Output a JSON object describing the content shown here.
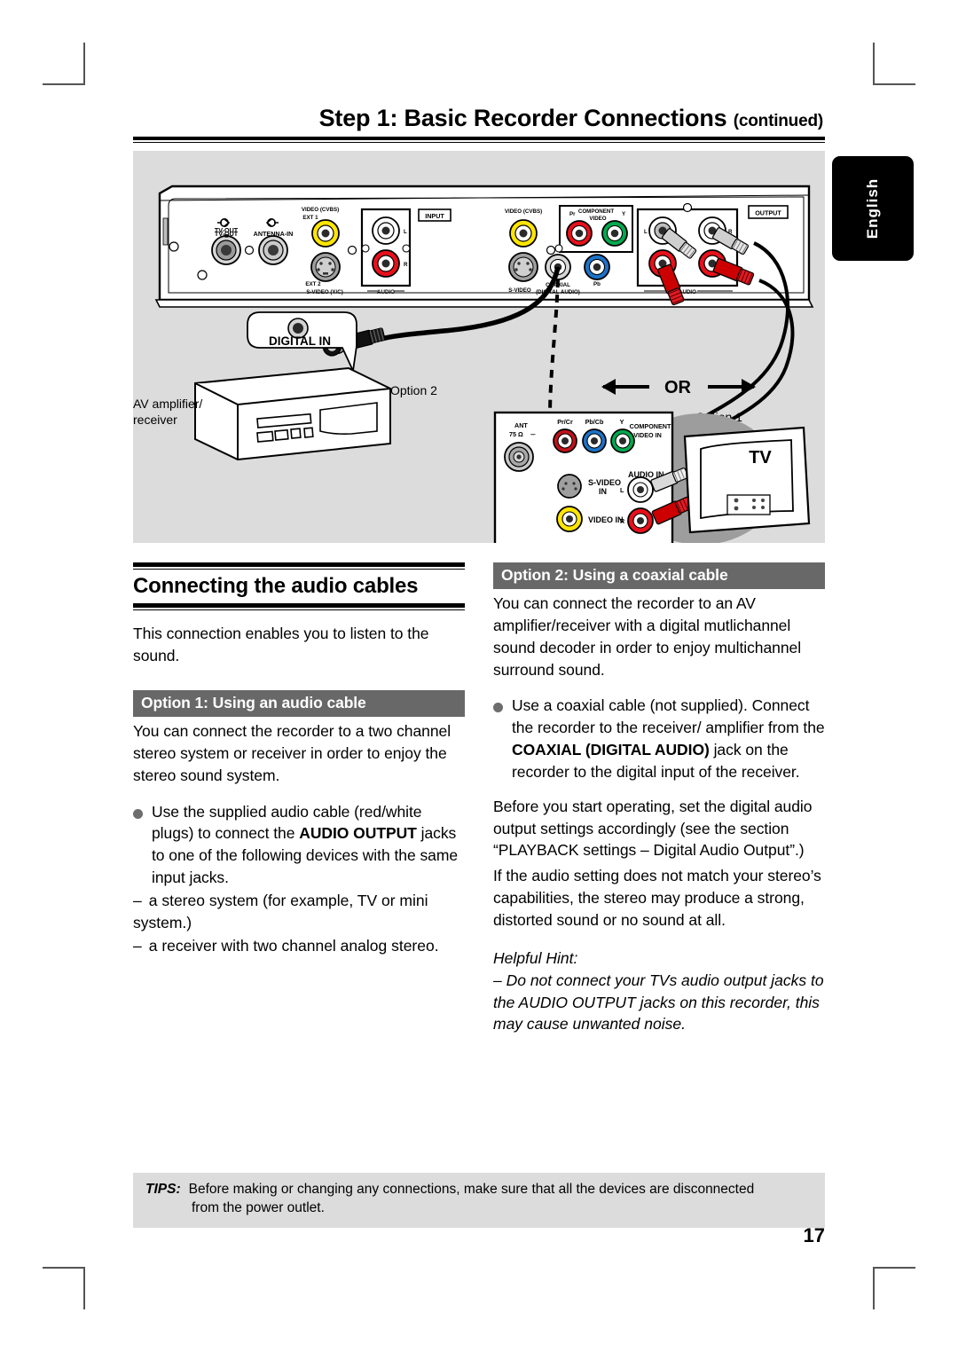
{
  "header": {
    "title": "Step 1: Basic Recorder Connections",
    "continued": "(continued)"
  },
  "side_tab": {
    "label": "English"
  },
  "diagram": {
    "recorder_panel": {
      "left": {
        "tv_out": "TV-OUT",
        "antenna_in": "ANTENNA-IN",
        "video_cvbs": "VIDEO (CVBS)",
        "ext1": "EXT 1",
        "ext2": "EXT 2",
        "svideo": "S-VIDEO (Y/C)",
        "audio": "AUDIO",
        "input": "INPUT"
      },
      "right": {
        "video_cvbs": "VIDEO (CVBS)",
        "svideo": "S-VIDEO",
        "coaxial": "COAXIAL",
        "digital_audio": "(DIGITAL AUDIO)",
        "pr": "Pr",
        "pb": "Pb",
        "y": "Y",
        "component_video": "COMPONENT VIDEO",
        "audio": "AUDIO",
        "output": "OUTPUT"
      }
    },
    "callout_digital_in": "DIGITAL IN",
    "label_option2": "Option 2",
    "label_option1": "Option 1",
    "label_or": "OR",
    "av_amplifier_line1": "AV amplifier/",
    "av_amplifier_line2": "receiver",
    "tv_panel": {
      "ant": "ANT",
      "ant_ohm": "75 Ω",
      "pr_cr": "Pr/Cr",
      "pb_cb": "Pb/Cb",
      "y": "Y",
      "component_video_in_l1": "COMPONENT",
      "component_video_in_l2": "VIDEO IN",
      "svideo_in_l1": "S-VIDEO",
      "svideo_in_l2": "IN",
      "audio_in": "AUDIO IN",
      "audio_l": "L",
      "audio_r": "R",
      "video_in": "VIDEO IN"
    },
    "tv_label": "TV"
  },
  "left_column": {
    "section_title": "Connecting the audio cables",
    "intro": "This connection enables you to listen to the sound.",
    "option_bar": "Option 1: Using an audio cable",
    "option_intro": "You can connect the recorder to a two channel stereo system or receiver in order to enjoy the stereo sound system.",
    "bullet": {
      "part1": "Use the supplied audio cable (red/white plugs) to connect the ",
      "bold1": "AUDIO OUTPUT",
      "part2": " jacks to one of the following devices with the same input jacks."
    },
    "dash1_mark": "–",
    "dash1_text": "a stereo system (for example, TV or mini system.)",
    "dash2_mark": "–",
    "dash2_text": "a receiver with two channel analog stereo."
  },
  "right_column": {
    "option_bar": "Option 2: Using a coaxial cable",
    "option_intro": "You can connect the recorder to an AV amplifier/receiver with a digital mutlichannel sound decoder in order to enjoy multichannel surround sound.",
    "bullet": {
      "part1": "Use a coaxial cable (not supplied). Connect the recorder to the receiver/ amplifier from the ",
      "bold1": "COAXIAL (DIGITAL AUDIO)",
      "part2": " jack on the recorder to the digital input of the receiver."
    },
    "para2": "Before you start operating, set the digital audio output settings accordingly (see the section “PLAYBACK settings – Digital Audio Output”.)",
    "para3": "If the audio setting does not match your stereo’s capabilities, the stereo may produce a strong, distorted sound or no sound at all.",
    "hint_title": "Helpful Hint:",
    "hint_text": "– Do not connect your TVs audio output jacks to the AUDIO OUTPUT jacks on this recorder, this may cause unwanted noise."
  },
  "footer": {
    "tips_label": "TIPS:",
    "tips_line1": "Before making or changing any connections, make sure that all the devices are disconnected",
    "tips_line2": "from the power outlet.",
    "page_number": "17"
  },
  "colors": {
    "panel_bg": "#dcdcdc",
    "option_bar": "#686868",
    "bullet": "#6d6d6d",
    "yellow": "#ffe500",
    "red": "#e8101b",
    "green": "#00a94f",
    "blue": "#1d72c8",
    "white": "#ffffff",
    "gray_jack": "#8a8a8a"
  }
}
